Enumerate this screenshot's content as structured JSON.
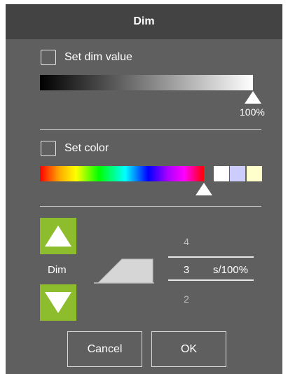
{
  "dialog": {
    "title": "Dim"
  },
  "dim_section": {
    "checkbox_label": "Set dim value",
    "checked": false,
    "value_percent": 100,
    "value_text": "100%"
  },
  "color_section": {
    "checkbox_label": "Set color",
    "checked": false,
    "hue_position_percent": 100,
    "swatches": [
      "#ffffff",
      "#ccccff",
      "#ffffcc"
    ]
  },
  "timing_section": {
    "label": "Dim",
    "picker": {
      "above": "4",
      "selected": "3",
      "below": "2",
      "unit": "s/100%"
    }
  },
  "buttons": {
    "cancel": "Cancel",
    "ok": "OK"
  },
  "colors": {
    "accent": "#8dbd2c",
    "titlebar": "#434343",
    "background": "#5f5f5f"
  }
}
